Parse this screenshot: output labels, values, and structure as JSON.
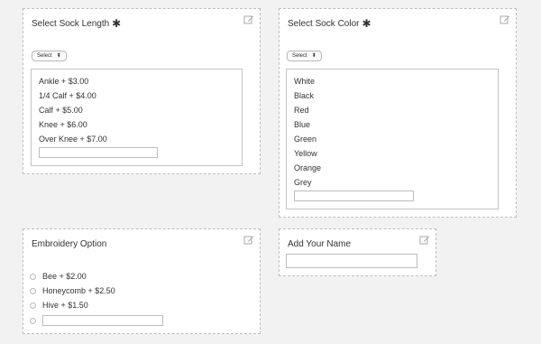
{
  "sock_length": {
    "title": "Select Sock Length",
    "required_mark": "✱",
    "select_label": "Select",
    "select_arrows": "⬍",
    "options": [
      "Ankle + $3.00",
      "1/4 Calf + $4.00",
      "Calf + $5.00",
      "Knee + $6.00",
      "Over Knee + $7.00"
    ]
  },
  "sock_color": {
    "title": "Select Sock Color",
    "required_mark": "✱",
    "select_label": "Select",
    "select_arrows": "⬍",
    "options": [
      "White",
      "Black",
      "Red",
      "Blue",
      "Green",
      "Yellow",
      "Orange",
      "Grey"
    ]
  },
  "embroidery": {
    "title": "Embroidery Option",
    "options": [
      "Bee + $2.00",
      "Honeycomb + $2.50",
      "Hive + $1.50"
    ]
  },
  "name_field": {
    "title": "Add Your Name"
  },
  "icons": {
    "edit": "edit-icon"
  }
}
